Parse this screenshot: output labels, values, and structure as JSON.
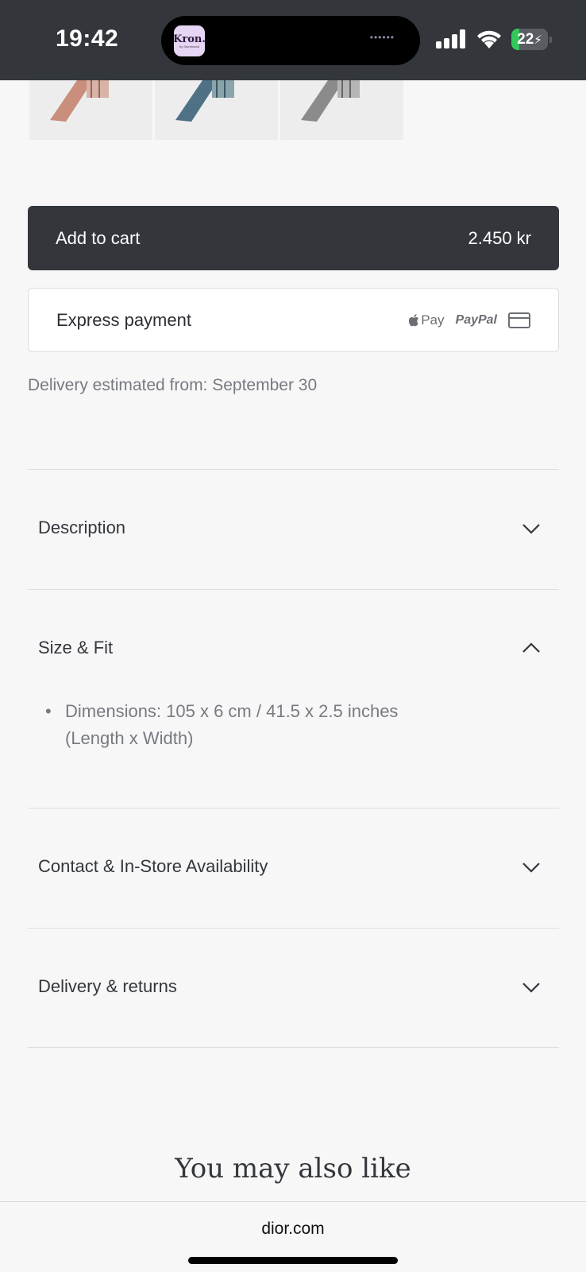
{
  "status_bar": {
    "time": "19:42",
    "app_icon_name": "Kron.",
    "app_icon_sub": "by Storebrand",
    "battery_level": "22",
    "battery_fraction": 0.22,
    "colors": {
      "background": "#33373c",
      "battery_fill": "#34c759"
    }
  },
  "product_thumbnails": [
    {
      "name": "pink-variant",
      "color": "#c98f7c"
    },
    {
      "name": "blue-variant",
      "color": "#4f7186"
    },
    {
      "name": "grey-variant",
      "color": "#8b8b8b"
    }
  ],
  "cart": {
    "label": "Add to cart",
    "price": "2.450 kr"
  },
  "express": {
    "label": "Express payment",
    "apple_pay": "Pay",
    "paypal": "PayPal",
    "icons": [
      "apple-pay-icon",
      "paypal-icon",
      "credit-card-icon"
    ]
  },
  "delivery_text": "Delivery estimated from: September 30",
  "accordion": {
    "description": "Description",
    "size_fit": "Size & Fit",
    "size_fit_detail": "Dimensions: 105 x 6 cm / 41.5 x 2.5 inches (Length x Width)",
    "contact": "Contact & In-Store Availability",
    "delivery_returns": "Delivery & returns"
  },
  "also_like_title": "You may also like",
  "browser": {
    "url": "dior.com"
  }
}
